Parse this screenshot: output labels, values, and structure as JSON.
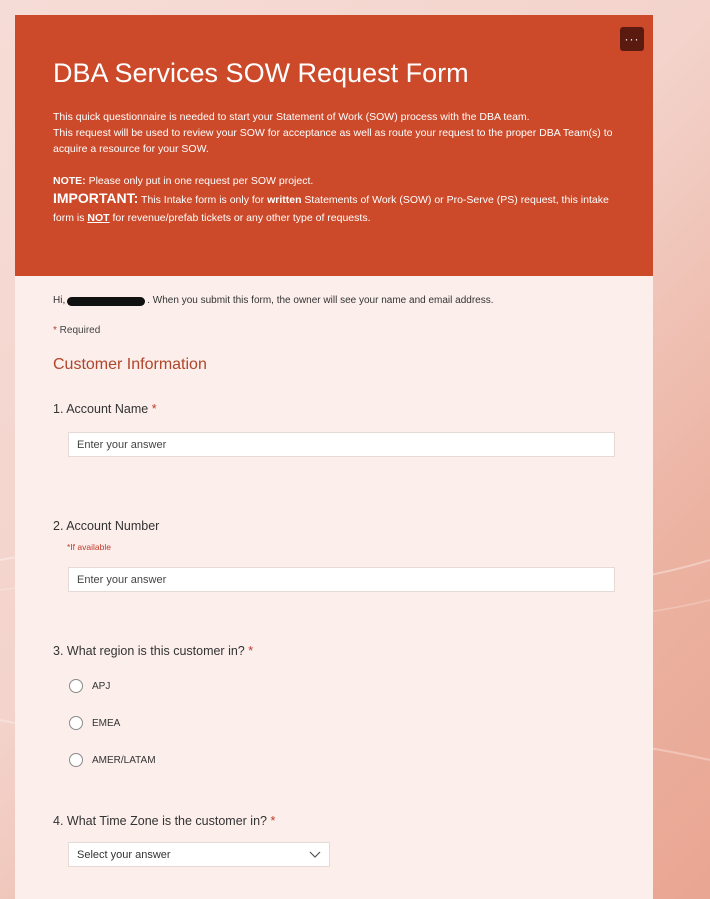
{
  "form": {
    "title": "DBA Services SOW Request Form",
    "more_label": "···",
    "description": [
      "This quick questionnaire is needed to start your Statement of Work (SOW) process with the DBA team.",
      "This request will be used to review your SOW for acceptance as well as route your request to the proper DBA Team(s) to acquire a resource for your SOW."
    ],
    "note_label": "NOTE:",
    "note_text": " Please only put in one request per SOW project.",
    "important_label": "IMPORTANT:",
    "important_text_1": " This Intake form is only for ",
    "important_bold": "written",
    "important_text_2": " Statements of Work (SOW) or Pro-Serve (PS) request, this intake form is ",
    "important_not": "NOT",
    "important_text_3": " for revenue/prefab tickets or any other type of requests."
  },
  "intro": {
    "hi_prefix": "Hi,",
    "hi_suffix": ". When you submit this form, the owner will see your name and email address.",
    "required_star": "*",
    "required_label": " Required"
  },
  "section": {
    "title": "Customer Information"
  },
  "questions": [
    {
      "label": "1. Account Name",
      "required": "*",
      "placeholder": "Enter your answer"
    },
    {
      "label": "2. Account Number",
      "hint": "*If available",
      "placeholder": "Enter your answer"
    },
    {
      "label": "3. What region is this customer in?",
      "required": "*",
      "options": [
        "APJ",
        "EMEA",
        "AMER/LATAM"
      ]
    },
    {
      "label": "4. What Time Zone is the customer in?",
      "required": "*",
      "select_placeholder": "Select your answer"
    }
  ],
  "colors": {
    "header": "#cc4a2a",
    "accent": "#b0452a",
    "required": "#c0392b"
  }
}
